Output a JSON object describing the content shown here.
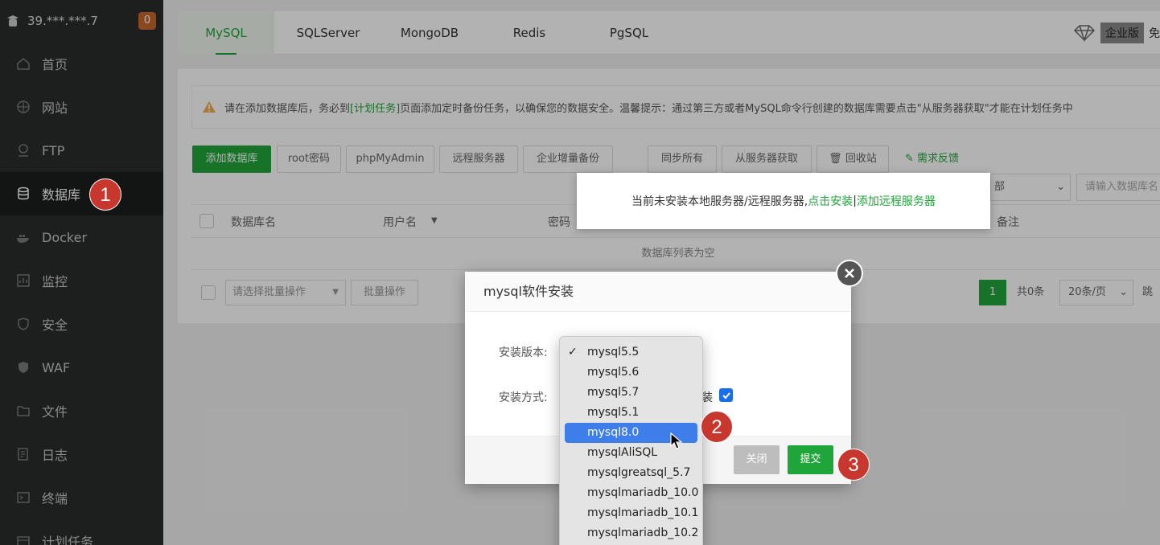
{
  "sidebar": {
    "server": "39.***.***.7",
    "badge": "0",
    "items": [
      {
        "label": "首页"
      },
      {
        "label": "网站"
      },
      {
        "label": "FTP"
      },
      {
        "label": "数据库"
      },
      {
        "label": "Docker"
      },
      {
        "label": "监控"
      },
      {
        "label": "安全"
      },
      {
        "label": "WAF"
      },
      {
        "label": "文件"
      },
      {
        "label": "日志"
      },
      {
        "label": "终端"
      },
      {
        "label": "计划任务"
      }
    ]
  },
  "tabs": [
    "MySQL",
    "SQLServer",
    "MongoDB",
    "Redis",
    "PgSQL"
  ],
  "enterprise": {
    "label": "企业版",
    "extra": "免"
  },
  "notice": {
    "prefix": "请在添加数据库后，务必到",
    "link": "[计划任务]",
    "suffix": "页面添加定时备份任务，以确保您的数据安全。温馨提示：通过第三方或者MySQL命令行创建的数据库需要点击\"从服务器获取\"才能在计划任务中"
  },
  "toolbar": {
    "add_db": "添加数据库",
    "root_pwd": "root密码",
    "phpmyadmin": "phpMyAdmin",
    "remote": "远程服务器",
    "backup": "企业增量备份",
    "sync_all": "同步所有",
    "fetch": "从服务器获取",
    "recycle": "回收站",
    "feedback": "需求反馈",
    "filter_value": "部",
    "search_placeholder": "请输入数据库名"
  },
  "table": {
    "headers": {
      "name": "数据库名",
      "user": "用户名",
      "pwd": "密码",
      "note": "备注"
    },
    "empty": "数据库列表为空"
  },
  "footer": {
    "batch_placeholder": "请选择批量操作",
    "batch_btn": "批量操作",
    "page": "1",
    "total": "共0条",
    "per_page": "20条/页",
    "jump": "跳"
  },
  "hint": {
    "text": "当前未安装本地服务器/远程服务器,",
    "install_link": "点击安装",
    "sep": " | ",
    "remote_link": "添加远程服务器"
  },
  "dialog": {
    "title": "mysql软件安装",
    "version_label": "安装版本:",
    "method_label": "安装方式:",
    "method_tail": "装",
    "close_btn": "关闭",
    "submit_btn": "提交"
  },
  "dropdown": {
    "selected_tick": "✓",
    "options": [
      "mysql5.5",
      "mysql5.6",
      "mysql5.7",
      "mysql5.1",
      "mysql8.0",
      "mysqlAliSQL",
      "mysqlgreatsql_5.7",
      "mysqlmariadb_10.0",
      "mysqlmariadb_10.1",
      "mysqlmariadb_10.2"
    ]
  },
  "steps": [
    "1",
    "2",
    "3"
  ]
}
